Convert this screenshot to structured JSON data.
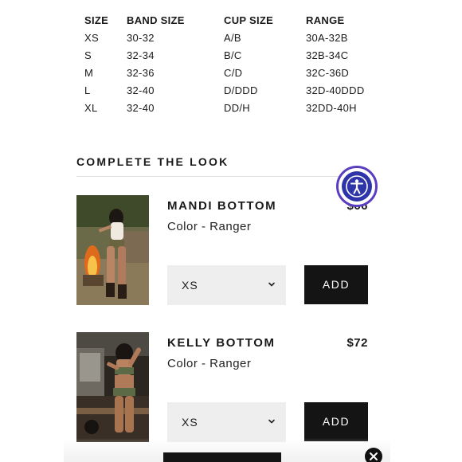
{
  "size_chart": {
    "headers": [
      "SIZE",
      "BAND SIZE",
      "CUP SIZE",
      "RANGE"
    ],
    "rows": [
      [
        "XS",
        "30-32",
        "A/B",
        "30A-32B"
      ],
      [
        "S",
        "32-34",
        "B/C",
        "32B-34C"
      ],
      [
        "M",
        "32-36",
        "C/D",
        "32C-36D"
      ],
      [
        "L",
        "32-40",
        "D/DDD",
        "32D-40DDD"
      ],
      [
        "XL",
        "32-40",
        "DD/H",
        "32DD-40H"
      ]
    ]
  },
  "complete_the_look": {
    "title": "COMPLETE THE LOOK",
    "products": [
      {
        "name": "MANDI BOTTOM",
        "price": "$66",
        "color": "Color - Ranger",
        "size_selected": "XS",
        "add_label": "ADD"
      },
      {
        "name": "KELLY BOTTOM",
        "price": "$72",
        "color": "Color - Ranger",
        "size_selected": "XS",
        "add_label": "ADD"
      }
    ]
  },
  "icons": {
    "accessibility": "accessibility-icon",
    "chevron": "chevron-down-icon",
    "close": "close-icon"
  },
  "colors": {
    "accent": "#2e35a8",
    "button": "#141414",
    "select_bg": "#eeeeee"
  }
}
